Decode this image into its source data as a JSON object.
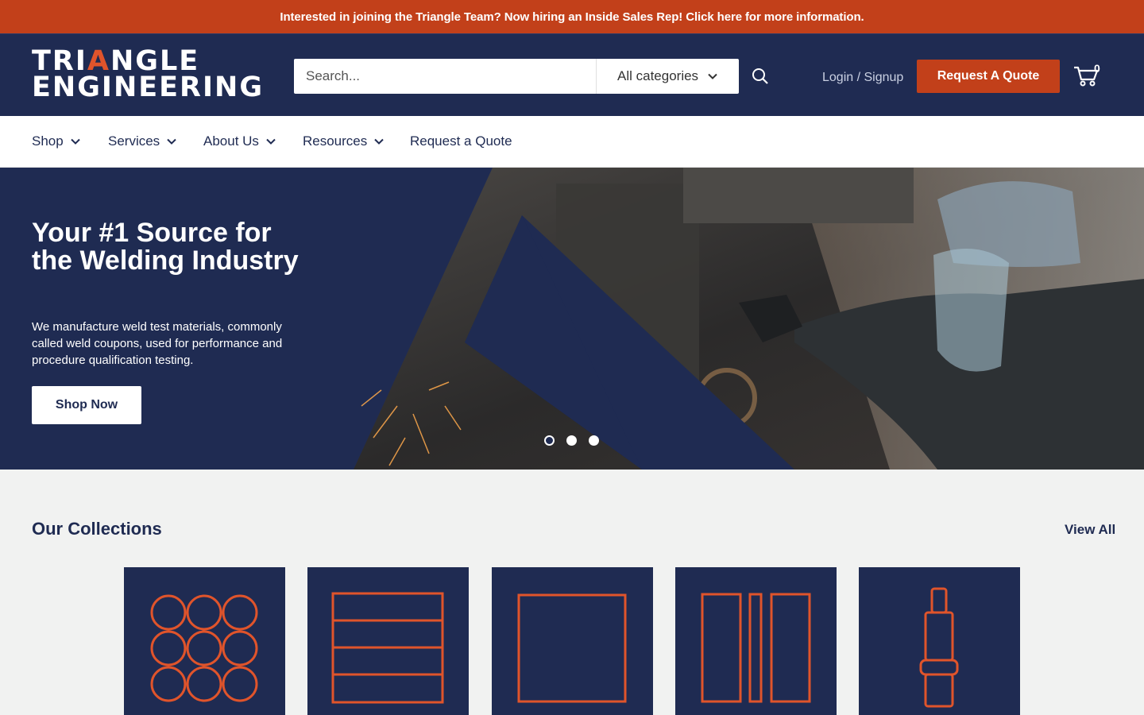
{
  "announcement": "Interested in joining the Triangle Team? Now hiring an Inside Sales Rep! Click here for more information.",
  "logo": {
    "line1_a": "TRI",
    "line1_accent": "A",
    "line1_b": "NGLE",
    "line2": "ENGINEERING"
  },
  "search": {
    "placeholder": "Search...",
    "category": "All categories"
  },
  "header": {
    "login": "Login / Signup",
    "quote_button": "Request A Quote",
    "cart_count": "0"
  },
  "nav": {
    "items": [
      "Shop",
      "Services",
      "About Us",
      "Resources",
      "Request a Quote"
    ]
  },
  "hero": {
    "title": "Your #1 Source for the Welding Industry",
    "subtitle": "We manufacture weld test materials, commonly called weld coupons, used for performance and procedure qualification testing.",
    "button": "Shop Now",
    "slides": 3,
    "active_slide": 1
  },
  "collections": {
    "title": "Our Collections",
    "view_all": "View All"
  },
  "colors": {
    "brand_navy": "#1f2b52",
    "accent_orange": "#c2401a",
    "icon_orange": "#e0542b"
  }
}
